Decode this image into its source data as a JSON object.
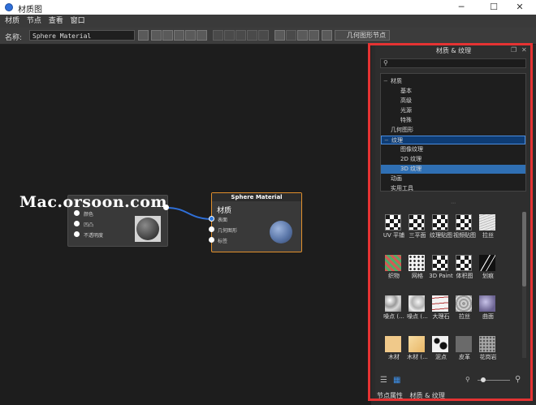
{
  "window": {
    "title": "材质图",
    "minimize_glyph": "─",
    "maximize_glyph": "☐",
    "close_glyph": "✕"
  },
  "menu": [
    "材质",
    "节点",
    "查看",
    "窗口"
  ],
  "toolbar": {
    "name_label": "名称:",
    "name_value": "Sphere Material",
    "geometry_node_label": "几何图形节点"
  },
  "watermark": "Mac.orsoon.com",
  "canvas": {
    "node_left": {
      "slots": [
        "颜色",
        "凹凸",
        "不透明度"
      ]
    },
    "node_right": {
      "header": "Sphere Material",
      "title": "材质",
      "slots": [
        "表面",
        "几何图形",
        "标签"
      ],
      "accent": "#e2902c"
    },
    "link_color": "#2f6fd8"
  },
  "panel": {
    "title": "材质 & 纹理",
    "tree": [
      {
        "label": "材质",
        "level": 0,
        "twisty": "−"
      },
      {
        "label": "基本",
        "level": 1
      },
      {
        "label": "高级",
        "level": 1
      },
      {
        "label": "光源",
        "level": 1
      },
      {
        "label": "特殊",
        "level": 1
      },
      {
        "label": "几何图形",
        "level": 0
      },
      {
        "label": "纹理",
        "level": 0,
        "twisty": "−",
        "selected": true
      },
      {
        "label": "图像纹理",
        "level": 1
      },
      {
        "label": "2D 纹理",
        "level": 1
      },
      {
        "label": "3D 纹理",
        "level": 1,
        "active": true
      },
      {
        "label": "动画",
        "level": 0
      },
      {
        "label": "实用工具",
        "level": 0
      }
    ],
    "splitter_glyph": "⋯",
    "textures": [
      {
        "name": "UV 平铺",
        "kind": "checker"
      },
      {
        "name": "三平面",
        "kind": "checker"
      },
      {
        "name": "纹理贴图",
        "kind": "checker"
      },
      {
        "name": "视频贴图",
        "kind": "checker"
      },
      {
        "name": "拉丝",
        "kind": "brushed"
      },
      {
        "name": "织物",
        "kind": "fabric"
      },
      {
        "name": "网格",
        "kind": "mesh"
      },
      {
        "name": "3D Paint",
        "kind": "checker"
      },
      {
        "name": "体积图",
        "kind": "checker"
      },
      {
        "name": "划痕",
        "kind": "scratch"
      },
      {
        "name": "噪点 (...",
        "kind": "noise"
      },
      {
        "name": "噪点 (...",
        "kind": "noise2"
      },
      {
        "name": "大理石",
        "kind": "marble"
      },
      {
        "name": "拉丝",
        "kind": "rings"
      },
      {
        "name": "曲面",
        "kind": "curved"
      },
      {
        "name": "木材",
        "kind": "wood"
      },
      {
        "name": "木材 (...",
        "kind": "wood2"
      },
      {
        "name": "泥点",
        "kind": "splat"
      },
      {
        "name": "皮革",
        "kind": "leather"
      },
      {
        "name": "花岗岩",
        "kind": "granite"
      }
    ],
    "bottom_tabs": [
      "节点属性",
      "材质 & 纹理"
    ]
  }
}
